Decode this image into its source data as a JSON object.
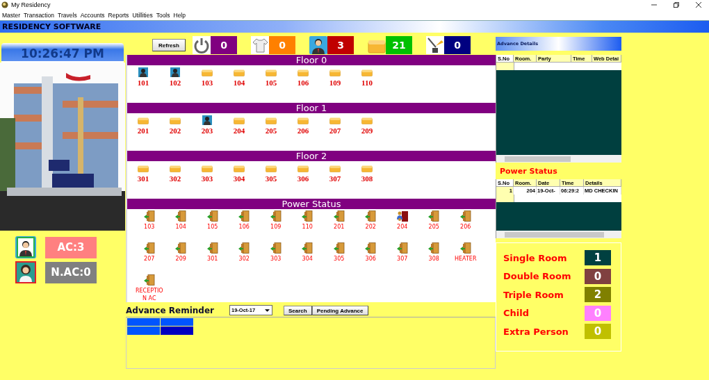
{
  "window": {
    "title": "My Residency"
  },
  "menu": [
    "Master",
    "Transaction",
    "Travels",
    "Accounts",
    "Reports",
    "Utillities",
    "Tools",
    "Help"
  ],
  "header": {
    "title": "RESIDENCY SOFTWARE"
  },
  "clock": "10:26:47 PM",
  "occupancy": [
    {
      "kind": "male",
      "label": "AC:3",
      "color": "#ff8080"
    },
    {
      "kind": "female",
      "label": "N.AC:0",
      "color": "#808080"
    }
  ],
  "toolbar": {
    "refresh": "Refresh",
    "counters": [
      {
        "kind": "power",
        "value": "0",
        "color": "#800080"
      },
      {
        "kind": "laundry",
        "value": "0",
        "color": "#ff8000"
      },
      {
        "kind": "guest",
        "value": "3",
        "color": "#c00000"
      },
      {
        "kind": "vacant",
        "value": "21",
        "color": "#00c000"
      },
      {
        "kind": "cleaning",
        "value": "0",
        "color": "#000080"
      }
    ]
  },
  "floors": [
    {
      "title": "Floor 0",
      "rooms": [
        {
          "number": "101",
          "occupied": true
        },
        {
          "number": "102",
          "occupied": true
        },
        {
          "number": "103",
          "occupied": false
        },
        {
          "number": "104",
          "occupied": false
        },
        {
          "number": "105",
          "occupied": false
        },
        {
          "number": "106",
          "occupied": false
        },
        {
          "number": "109",
          "occupied": false
        },
        {
          "number": "110",
          "occupied": false
        }
      ]
    },
    {
      "title": "Floor 1",
      "rooms": [
        {
          "number": "201",
          "occupied": false
        },
        {
          "number": "202",
          "occupied": false
        },
        {
          "number": "203",
          "occupied": true
        },
        {
          "number": "204",
          "occupied": false
        },
        {
          "number": "205",
          "occupied": false
        },
        {
          "number": "206",
          "occupied": false
        },
        {
          "number": "207",
          "occupied": false
        },
        {
          "number": "209",
          "occupied": false
        }
      ]
    },
    {
      "title": "Floor 2",
      "rooms": [
        {
          "number": "301",
          "occupied": false
        },
        {
          "number": "302",
          "occupied": false
        },
        {
          "number": "303",
          "occupied": false
        },
        {
          "number": "304",
          "occupied": false
        },
        {
          "number": "305",
          "occupied": false
        },
        {
          "number": "306",
          "occupied": false
        },
        {
          "number": "307",
          "occupied": false
        },
        {
          "number": "308",
          "occupied": false
        }
      ]
    }
  ],
  "power_status": {
    "title": "Power Status",
    "items": [
      {
        "label": "103",
        "occupied": false
      },
      {
        "label": "104",
        "occupied": false
      },
      {
        "label": "105",
        "occupied": false
      },
      {
        "label": "106",
        "occupied": false
      },
      {
        "label": "109",
        "occupied": false
      },
      {
        "label": "110",
        "occupied": false
      },
      {
        "label": "201",
        "occupied": false
      },
      {
        "label": "202",
        "occupied": false
      },
      {
        "label": "204",
        "occupied": true
      },
      {
        "label": "205",
        "occupied": false
      },
      {
        "label": "206",
        "occupied": false
      },
      {
        "label": "207",
        "occupied": false
      },
      {
        "label": "209",
        "occupied": false
      },
      {
        "label": "301",
        "occupied": false
      },
      {
        "label": "302",
        "occupied": false
      },
      {
        "label": "303",
        "occupied": false
      },
      {
        "label": "304",
        "occupied": false
      },
      {
        "label": "305",
        "occupied": false
      },
      {
        "label": "306",
        "occupied": false
      },
      {
        "label": "307",
        "occupied": false
      },
      {
        "label": "308",
        "occupied": false
      },
      {
        "label": "HEATER",
        "occupied": false
      },
      {
        "label": "RECEPTIO N AC",
        "occupied": false
      }
    ]
  },
  "advance_reminder": {
    "title": "Advance Reminder",
    "date": "19-Oct-17",
    "buttons": [
      "Search",
      "Pending Advance"
    ]
  },
  "advance_details": {
    "title": "Advance Details",
    "columns": [
      "S.No",
      "Room.",
      "Party",
      "Time",
      "Web Detai"
    ]
  },
  "power_log": {
    "title": "Power Status",
    "columns": [
      "S.No",
      "Room.",
      "Date",
      "Time",
      "Details"
    ],
    "rows": [
      [
        "1",
        "204",
        "19-Oct-",
        "06:29:2",
        "MD CHECKIN"
      ]
    ]
  },
  "summary": [
    {
      "label": "Single Room",
      "value": "1",
      "color": "#004040"
    },
    {
      "label": "Double Room",
      "value": "0",
      "color": "#804040"
    },
    {
      "label": "Triple Room",
      "value": "2",
      "color": "#808000"
    },
    {
      "label": "Child",
      "value": "0",
      "color": "#ff80ff"
    },
    {
      "label": "Extra Person",
      "value": "0",
      "color": "#c0c000"
    }
  ]
}
